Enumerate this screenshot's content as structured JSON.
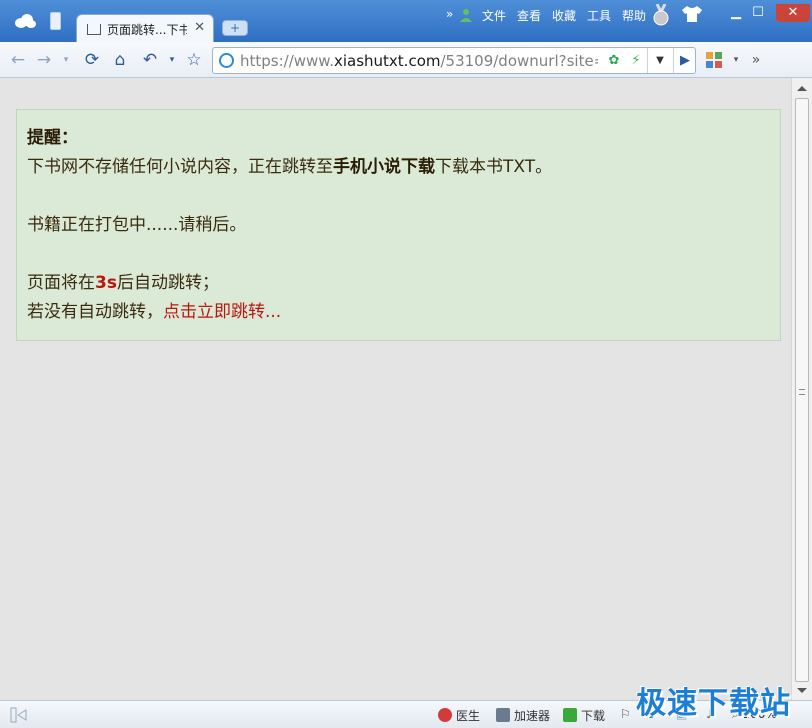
{
  "browser": {
    "tab_title": "页面跳转...下书",
    "menus": [
      "文件",
      "查看",
      "收藏",
      "工具",
      "帮助"
    ],
    "address_url_prefix": "https://www.",
    "address_url_host": "xiashutxt.com",
    "address_url_path": "/53109/downurl?site=",
    "overflow": "»",
    "status_items": [
      "医生",
      "加速器",
      "下载",
      "100%"
    ],
    "watermark": "极速下载站"
  },
  "notice": {
    "heading": "提醒：",
    "line1_before": "下书网不存储任何小说内容，正在跳转至",
    "line1_bold": "手机小说下载",
    "line1_after": "下载本书TXT。",
    "line2": "书籍正在打包中......请稍后。",
    "line3_before": "页面将在",
    "line3_countdown": "3s",
    "line3_after": "后自动跳转；",
    "line4_before": "若没有自动跳转，",
    "line4_link": "点击立即跳转..."
  },
  "colors": {
    "accent": "#2f6fc2",
    "notice_bg": "#dbead6",
    "highlight": "#b8160f"
  }
}
